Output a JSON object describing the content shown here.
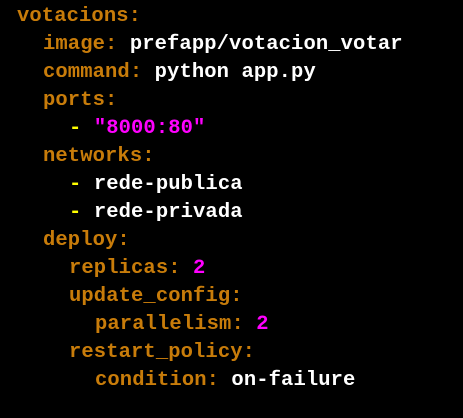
{
  "colors": {
    "background": "#000000",
    "key": "#c87c0a",
    "string": "#ff00ff",
    "number": "#ff00ff",
    "plain": "#ffffff",
    "dash": "#ffff00"
  },
  "lines": [
    {
      "indent": 0,
      "key": "votacions",
      "colon": ":"
    },
    {
      "indent": 1,
      "key": "image",
      "colon": ":",
      "value": " prefapp/votacion_votar",
      "vtype": "plain"
    },
    {
      "indent": 1,
      "key": "command",
      "colon": ":",
      "value": " python app.py",
      "vtype": "plain"
    },
    {
      "indent": 1,
      "key": "ports",
      "colon": ":"
    },
    {
      "indent": 2,
      "dash": "- ",
      "value": "\"8000:80\"",
      "vtype": "string"
    },
    {
      "indent": 1,
      "key": "networks",
      "colon": ":"
    },
    {
      "indent": 2,
      "dash": "- ",
      "value": "rede-publica",
      "vtype": "plain"
    },
    {
      "indent": 2,
      "dash": "- ",
      "value": "rede-privada",
      "vtype": "plain"
    },
    {
      "indent": 1,
      "key": "deploy",
      "colon": ":"
    },
    {
      "indent": 2,
      "key": "replicas",
      "colon": ":",
      "value": " 2",
      "vtype": "number"
    },
    {
      "indent": 2,
      "key": "update_config",
      "colon": ":"
    },
    {
      "indent": 3,
      "key": "parallelism",
      "colon": ":",
      "value": " 2",
      "vtype": "number"
    },
    {
      "indent": 2,
      "key": "restart_policy",
      "colon": ":"
    },
    {
      "indent": 3,
      "key": "condition",
      "colon": ":",
      "value": " on-failure",
      "vtype": "plain"
    }
  ]
}
